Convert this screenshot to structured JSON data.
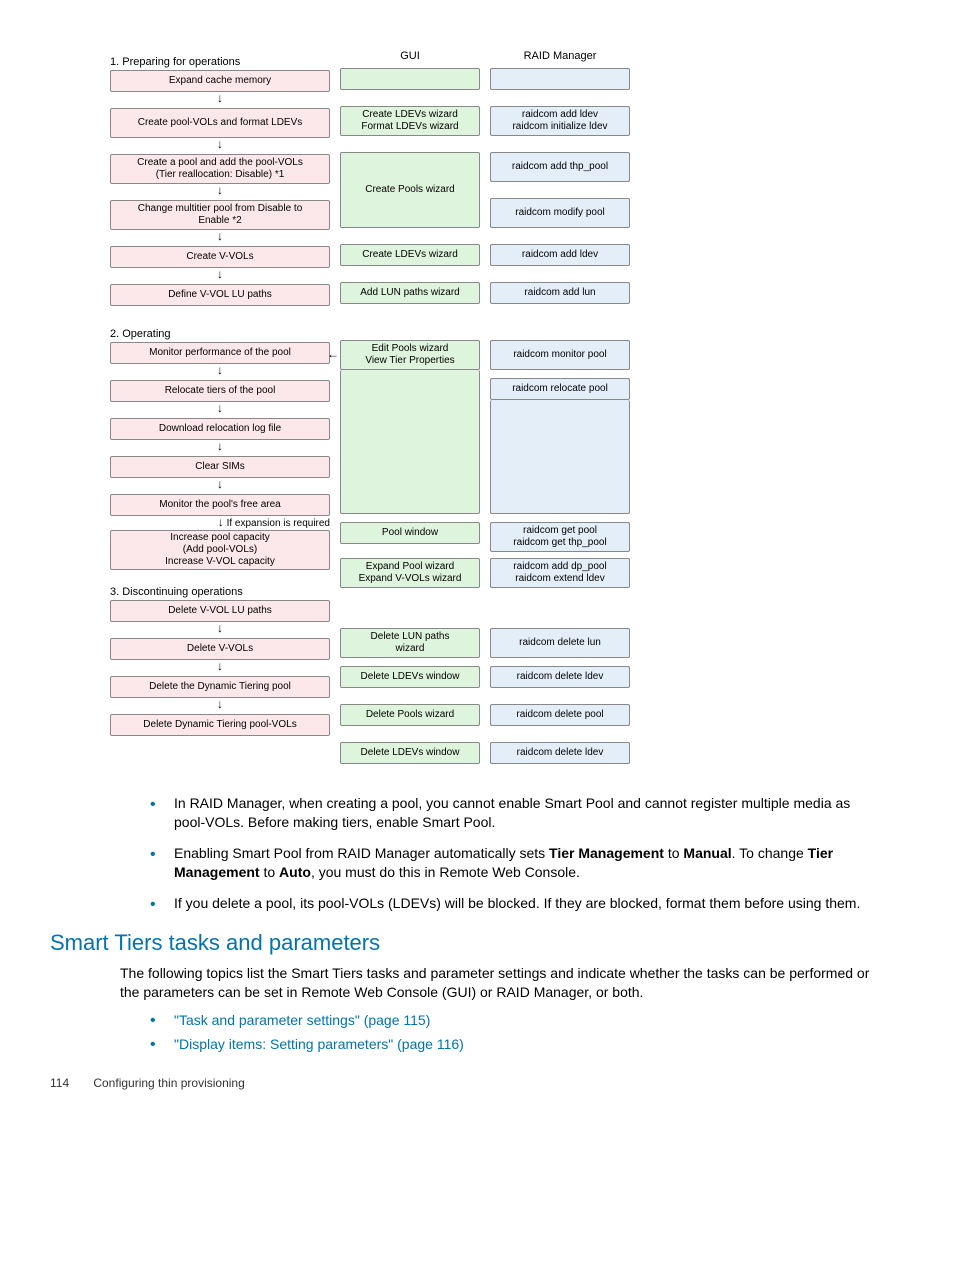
{
  "diagram": {
    "headers": {
      "flow": "",
      "gui": "GUI",
      "raid": "RAID Manager"
    },
    "section1": "1. Preparing for operations",
    "s1_flow": {
      "expand": "Expand cache memory",
      "createPool": "Create pool-VOLs and format LDEVs",
      "createAdd": "Create a pool and add the pool-VOLs\n(Tier reallocation: Disable) *1",
      "changeMulti": "Change multitier pool from Disable to\nEnable *2",
      "createVvol": "Create V-VOLs",
      "defineLu": "Define V-VOL LU paths"
    },
    "s1_gui": {
      "createLdevs": "Create LDEVs wizard\nFormat LDEVs wizard",
      "createPools": "Create Pools wizard",
      "createLdevs2": "Create LDEVs wizard",
      "addLun": "Add LUN paths wizard"
    },
    "s1_raid": {
      "addLdev": "raidcom add ldev\nraidcom initialize ldev",
      "addThp": "raidcom add thp_pool",
      "modifyPool": "raidcom modify pool",
      "addLdev2": "raidcom add ldev",
      "addLun": "raidcom add lun"
    },
    "section2": "2. Operating",
    "s2_flow": {
      "monitor": "Monitor performance of the pool",
      "relocate": "Relocate tiers of the pool",
      "download": "Download relocation log file",
      "clearSims": "Clear SIMs",
      "monitorFree": "Monitor the pool's free area",
      "expansionNote": "If expansion is required",
      "increase": "Increase pool capacity\n(Add pool-VOLs)\nIncrease V-VOL capacity"
    },
    "s2_gui": {
      "editView": "Edit Pools wizard\nView Tier Properties",
      "poolWindow": "Pool window",
      "expandPool": "Expand Pool wizard\nExpand V-VOLs wizard"
    },
    "s2_raid": {
      "monitorPool": "raidcom monitor pool",
      "relocatePool": "raidcom relocate pool",
      "getPool": "raidcom get pool\nraidcom get thp_pool",
      "addDp": "raidcom add dp_pool\nraidcom extend ldev"
    },
    "section3": "3. Discontinuing operations",
    "s3_flow": {
      "deleteLu": "Delete V-VOL LU paths",
      "deleteVvol": "Delete V-VOLs",
      "deleteDt": "Delete the Dynamic Tiering pool",
      "deleteDtVols": "Delete Dynamic Tiering pool-VOLs"
    },
    "s3_gui": {
      "deleteLun": "Delete LUN paths\nwizard",
      "deleteLdevs": "Delete LDEVs window",
      "deletePools": "Delete Pools wizard",
      "deleteLdevs2": "Delete LDEVs window"
    },
    "s3_raid": {
      "deleteLun": "raidcom delete lun",
      "deleteLdev": "raidcom delete ldev",
      "deletePool": "raidcom delete pool",
      "deleteLdev2": "raidcom delete ldev"
    }
  },
  "bullets": {
    "b1a": "In RAID Manager, when creating a pool, you cannot enable Smart Pool and cannot register multiple media as pool-VOLs. Before making tiers, enable Smart Pool.",
    "b2a": "Enabling Smart Pool from RAID Manager automatically sets ",
    "b2b": "Tier Management",
    "b2c": " to ",
    "b2d": "Manual",
    "b2e": ". To change ",
    "b2f": "Tier Management",
    "b2g": " to ",
    "b2h": "Auto",
    "b2i": ", you must do this in Remote Web Console.",
    "b3a": "If you delete a pool, its pool-VOLs (LDEVs) will be blocked. If they are blocked, format them before using them."
  },
  "heading": "Smart Tiers tasks and parameters",
  "para": "The following topics list the Smart Tiers tasks and parameter settings and indicate whether the tasks can be performed or the parameters can be set in Remote Web Console (GUI) or RAID Manager, or both.",
  "links": {
    "l1": "\"Task and parameter settings\" (page 115)",
    "l2": "\"Display items: Setting parameters\" (page 116)"
  },
  "footer": {
    "page": "114",
    "title": "Configuring thin provisioning"
  }
}
